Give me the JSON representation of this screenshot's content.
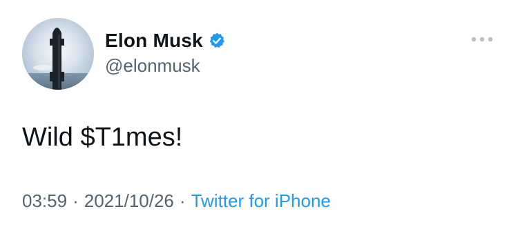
{
  "user": {
    "display_name": "Elon Musk",
    "handle": "@elonmusk",
    "verified": true
  },
  "tweet": {
    "text": "Wild $T1mes!",
    "time": "03:59",
    "date": "2021/10/26",
    "separator": "·",
    "source": "Twitter for iPhone"
  },
  "icons": {
    "verified": "verified-badge-icon",
    "more": "more-options-icon",
    "avatar": "starship-rocket-avatar"
  },
  "colors": {
    "name": "#0f1419",
    "secondary": "#536471",
    "accent": "#1d9bf0",
    "more_dots": "#b8c0c7"
  }
}
